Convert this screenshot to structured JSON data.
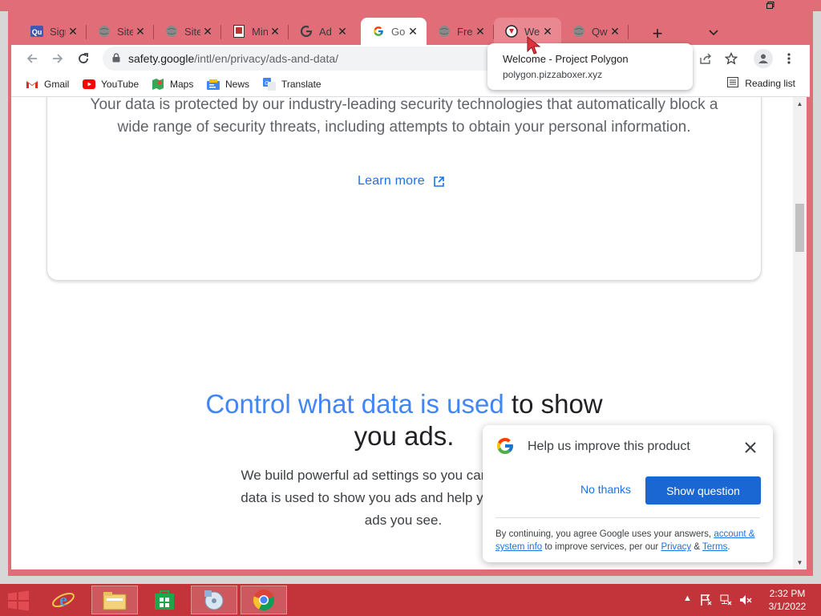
{
  "browser": {
    "tabs": [
      {
        "favicon": "quizlet-favicon",
        "title": "Sign"
      },
      {
        "favicon": "globe-favicon",
        "title": "Site"
      },
      {
        "favicon": "globe-favicon",
        "title": "Site"
      },
      {
        "favicon": "book-favicon",
        "title": "Min"
      },
      {
        "favicon": "google-favicon",
        "title": "Ad"
      },
      {
        "favicon": "google-favicon",
        "title": "Goo",
        "active": true
      },
      {
        "favicon": "globe-favicon",
        "title": "Free"
      },
      {
        "favicon": "polygon-favicon",
        "title": "We"
      },
      {
        "favicon": "globe-favicon",
        "title": "Qw"
      }
    ],
    "url": {
      "host": "safety.google",
      "path": "/intl/en/privacy/ads-and-data/"
    },
    "bookmarks": [
      {
        "icon": "gmail-icon",
        "label": "Gmail"
      },
      {
        "icon": "youtube-icon",
        "label": "YouTube"
      },
      {
        "icon": "maps-icon",
        "label": "Maps"
      },
      {
        "icon": "news-icon",
        "label": "News"
      },
      {
        "icon": "translate-icon",
        "label": "Translate"
      }
    ],
    "reading_list": "Reading list"
  },
  "tooltip": {
    "title": "Welcome - Project Polygon",
    "url": "polygon.pizzaboxer.xyz"
  },
  "page": {
    "card_text": "Your data is protected by our industry-leading security technologies that automatically block a wide range of security threats, including attempts to obtain your personal information.",
    "learn_more": "Learn more",
    "headline_blue": "Control what data is used",
    "headline_rest": " to show you ads.",
    "body_text": "We build powerful ad settings so you can control what data is used to show you ads and help you control the ads you see."
  },
  "survey": {
    "title": "Help us improve this product",
    "no_thanks": "No thanks",
    "show_question": "Show question",
    "disclaimer_pre": "By continuing, you agree Google uses your answers, ",
    "disclaimer_link1": "account & system info",
    "disclaimer_mid": " to improve services, per our ",
    "disclaimer_link2": "Privacy",
    "disclaimer_amp": " & ",
    "disclaimer_link3": "Terms",
    "disclaimer_end": "."
  },
  "taskbar": {
    "apps": [
      "internet-explorer-icon",
      "file-explorer-icon",
      "store-icon",
      "media-center-icon",
      "chrome-icon"
    ],
    "time": "2:32 PM",
    "date": "3/1/2022"
  },
  "colors": {
    "frame": "#e06d77",
    "taskbar": "#c3343a",
    "accent_blue": "#1a73e8",
    "headline_blue": "#4285f4"
  }
}
